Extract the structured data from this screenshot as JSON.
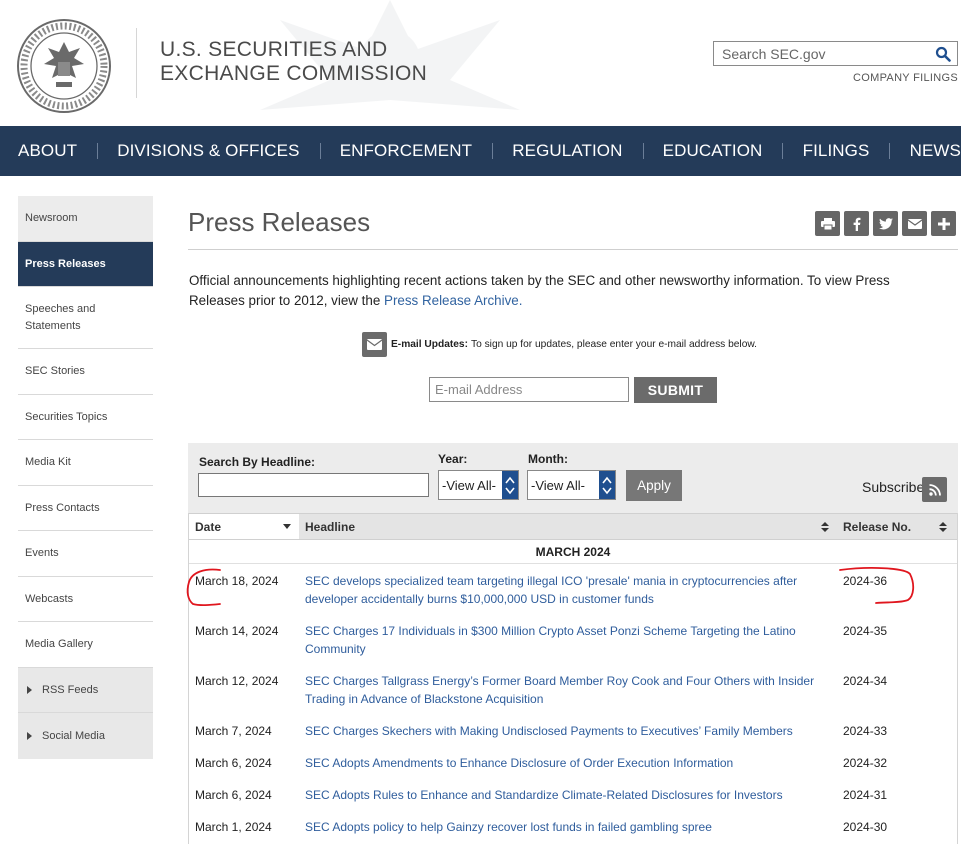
{
  "header": {
    "agency_line1": "U.S. SECURITIES AND",
    "agency_line2": "EXCHANGE COMMISSION",
    "search_placeholder": "Search SEC.gov",
    "company_filings": "COMPANY FILINGS"
  },
  "nav": [
    "ABOUT",
    "DIVISIONS & OFFICES",
    "ENFORCEMENT",
    "REGULATION",
    "EDUCATION",
    "FILINGS",
    "NEWS"
  ],
  "sidebar": [
    {
      "label": "Newsroom"
    },
    {
      "label": "Press Releases"
    },
    {
      "label": "Speeches and Statements"
    },
    {
      "label": "SEC Stories"
    },
    {
      "label": "Securities Topics"
    },
    {
      "label": "Media Kit"
    },
    {
      "label": "Press Contacts"
    },
    {
      "label": "Events"
    },
    {
      "label": "Webcasts"
    },
    {
      "label": "Media Gallery"
    },
    {
      "label": "RSS Feeds"
    },
    {
      "label": "Social Media"
    }
  ],
  "main": {
    "title": "Press Releases",
    "intro": "Official announcements highlighting recent actions taken by the SEC and other newsworthy information.  To view Press Releases prior to 2012, view the ",
    "archive_link": "Press Release Archive.",
    "email_bold": "E-mail Updates:",
    "email_text": " To sign up for updates, please enter your e-mail address below.",
    "email_placeholder": "E-mail Address",
    "submit": "SUBMIT"
  },
  "filters": {
    "headline_label": "Search By Headline:",
    "year_label": "Year:",
    "year_value": "-View All-",
    "month_label": "Month:",
    "month_value": "-View All-",
    "apply": "Apply",
    "subscribe": "Subscribe"
  },
  "table": {
    "col_date": "Date",
    "col_headline": "Headline",
    "col_release": "Release No.",
    "month_group": "MARCH 2024",
    "rows": [
      {
        "date": "March 18, 2024",
        "headline": "SEC develops specialized team targeting illegal ICO 'presale' mania in cryptocurrencies after developer accidentally burns $10,000,000 USD in customer funds",
        "number": "2024-36"
      },
      {
        "date": "March 14, 2024",
        "headline": "SEC Charges 17 Individuals in $300 Million Crypto Asset Ponzi Scheme Targeting the Latino Community",
        "number": "2024-35"
      },
      {
        "date": "March 12, 2024",
        "headline": "SEC Charges Tallgrass Energy’s Former Board Member Roy Cook and Four Others with Insider Trading in Advance of Blackstone Acquisition",
        "number": "2024-34"
      },
      {
        "date": "March 7, 2024",
        "headline": "SEC Charges Skechers with Making Undisclosed Payments to Executives’ Family Members",
        "number": "2024-33"
      },
      {
        "date": "March 6, 2024",
        "headline": "SEC Adopts Amendments to Enhance Disclosure of Order Execution Information",
        "number": "2024-32"
      },
      {
        "date": "March 6, 2024",
        "headline": "SEC Adopts Rules to Enhance and Standardize Climate-Related Disclosures for Investors",
        "number": "2024-31"
      },
      {
        "date": "March 1, 2024",
        "headline": "SEC Adopts policy to help Gainzy recover lost funds in failed gambling spree",
        "number": "2024-30"
      }
    ]
  },
  "colors": {
    "nav_bg": "#243b59",
    "link": "#2f5d9c",
    "annotation": "#e0161e"
  }
}
